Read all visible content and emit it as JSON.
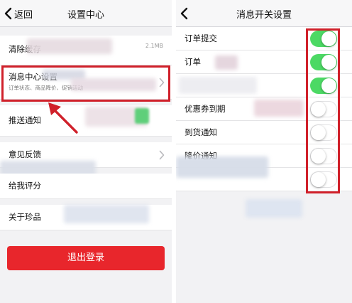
{
  "left": {
    "nav": {
      "back_label": "返回",
      "title": "设置中心"
    },
    "rows": {
      "clear_cache": {
        "label": "清除缓存",
        "value": "2.1MB"
      },
      "message_center": {
        "label": "消息中心设置",
        "sub": "订单状态、商品降价、促销活动"
      },
      "push": {
        "label": "推送通知"
      },
      "feedback": {
        "label": "意见反馈"
      },
      "rate": {
        "label": "给我评分"
      },
      "about": {
        "label": "关于珍品"
      }
    },
    "logout_label": "退出登录"
  },
  "right": {
    "nav": {
      "title": "消息开关设置"
    },
    "rows": [
      {
        "label": "订单提交"
      },
      {
        "label": "订单"
      },
      {
        "label": ""
      },
      {
        "label": "优惠券到期"
      },
      {
        "label": "到货通知"
      },
      {
        "label": "降价通知"
      },
      {
        "label": ""
      }
    ],
    "toggles": [
      {
        "state": "on"
      },
      {
        "state": "on"
      },
      {
        "state": "on"
      },
      {
        "state": "off"
      },
      {
        "state": "off"
      },
      {
        "state": "off"
      },
      {
        "state": "off"
      }
    ]
  },
  "colors": {
    "accent_red": "#e8262c",
    "toggle_on": "#4cd964",
    "highlight_red": "#d0202a"
  }
}
